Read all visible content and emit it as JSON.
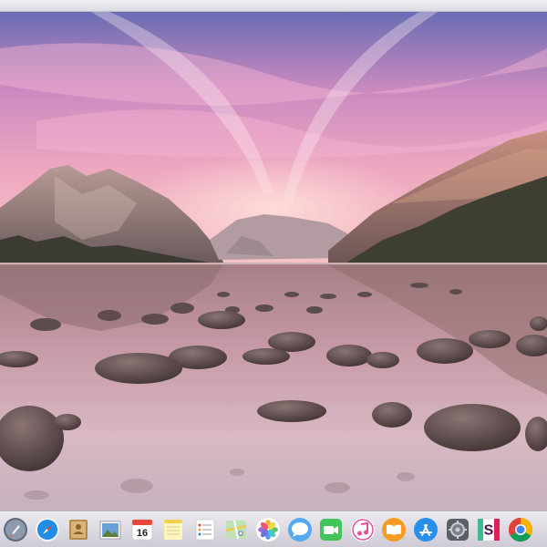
{
  "window": {
    "title": ""
  },
  "desktop": {
    "wallpaper_icon": "mountain-lake-wallpaper",
    "colors": {
      "sky_top": "#6f6fb8",
      "sky_pink": "#e08fb6",
      "horizon": "#f3c2c9",
      "mountain": "#8a6a68",
      "water": "#c8a3ae",
      "rock": "#4a3a3a"
    }
  },
  "dock": {
    "items": [
      {
        "name": "launchpad",
        "icon": "rocket-icon"
      },
      {
        "name": "safari",
        "icon": "compass-icon"
      },
      {
        "name": "contacts",
        "icon": "address-book-icon"
      },
      {
        "name": "preview",
        "icon": "photo-preview-icon"
      },
      {
        "name": "calendar",
        "icon": "calendar-icon",
        "label": "16"
      },
      {
        "name": "notes",
        "icon": "notes-icon"
      },
      {
        "name": "reminders",
        "icon": "checklist-icon"
      },
      {
        "name": "maps",
        "icon": "map-icon"
      },
      {
        "name": "photos",
        "icon": "flower-icon"
      },
      {
        "name": "messages",
        "icon": "speech-bubble-icon"
      },
      {
        "name": "facetime",
        "icon": "video-camera-icon"
      },
      {
        "name": "itunes",
        "icon": "music-note-icon"
      },
      {
        "name": "ibooks",
        "icon": "book-icon"
      },
      {
        "name": "app-store",
        "icon": "app-store-icon"
      },
      {
        "name": "system-preferences",
        "icon": "gear-icon"
      },
      {
        "name": "slack",
        "icon": "slack-icon",
        "label": "S"
      },
      {
        "name": "chrome",
        "icon": "chrome-icon"
      }
    ]
  }
}
